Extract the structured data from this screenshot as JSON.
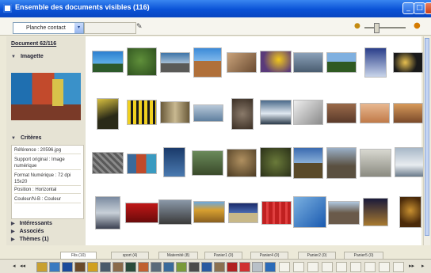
{
  "window": {
    "title": "Ensemble des documents visibles (116)",
    "controls": [
      "_",
      "□",
      "×"
    ]
  },
  "toolbar": {
    "view_select": "Planche contact",
    "view_select_arrow": "▾",
    "zoom_min_icon": "small-zoom-icon",
    "zoom_max_icon": "large-zoom-icon"
  },
  "left_panel": {
    "doc_counter": "Document 62/116",
    "sections": {
      "thumbnail": "Imagette",
      "criteria": "Critères",
      "interests": "Intéressants",
      "associations": "Associés",
      "themes": "Thèmes (1)"
    },
    "criteria": [
      "Référence : 20596.jpg",
      "Support original : Image numérique",
      "Format Numérique : 72 dpi 15x20",
      "Position : Horizontal",
      "Couleur/N-B : Couleur"
    ]
  },
  "tabs": [
    "Fils (10)",
    "sport (4)",
    "Maternité (8)",
    "Panier1 (0)",
    "Panier4 (0)",
    "Panier2 (0)",
    "Panier5 (0)"
  ],
  "colors": {
    "titlebar": "#0a52d6",
    "panel": "#e6e3d4"
  }
}
